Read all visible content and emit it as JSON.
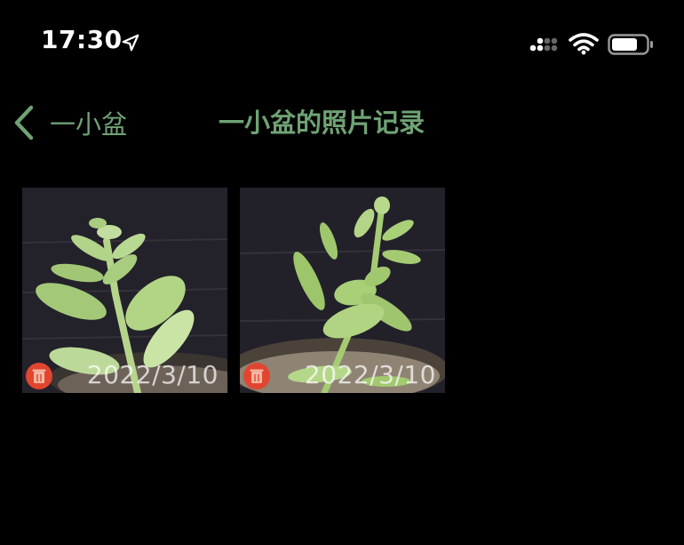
{
  "status_bar": {
    "time": "17:30",
    "icons": [
      "location-arrow-icon",
      "cellular-signal-icon",
      "wifi-icon",
      "battery-icon"
    ]
  },
  "nav": {
    "back_label": "一小盆",
    "title": "一小盆的照片记录",
    "accent_color": "#6fa274"
  },
  "photos": [
    {
      "date": "2022/3/10",
      "delete_icon": "trash-icon"
    },
    {
      "date": "2022/3/10",
      "delete_icon": "trash-icon"
    }
  ],
  "colors": {
    "background": "#000000",
    "delete_badge": "#e2452f"
  }
}
